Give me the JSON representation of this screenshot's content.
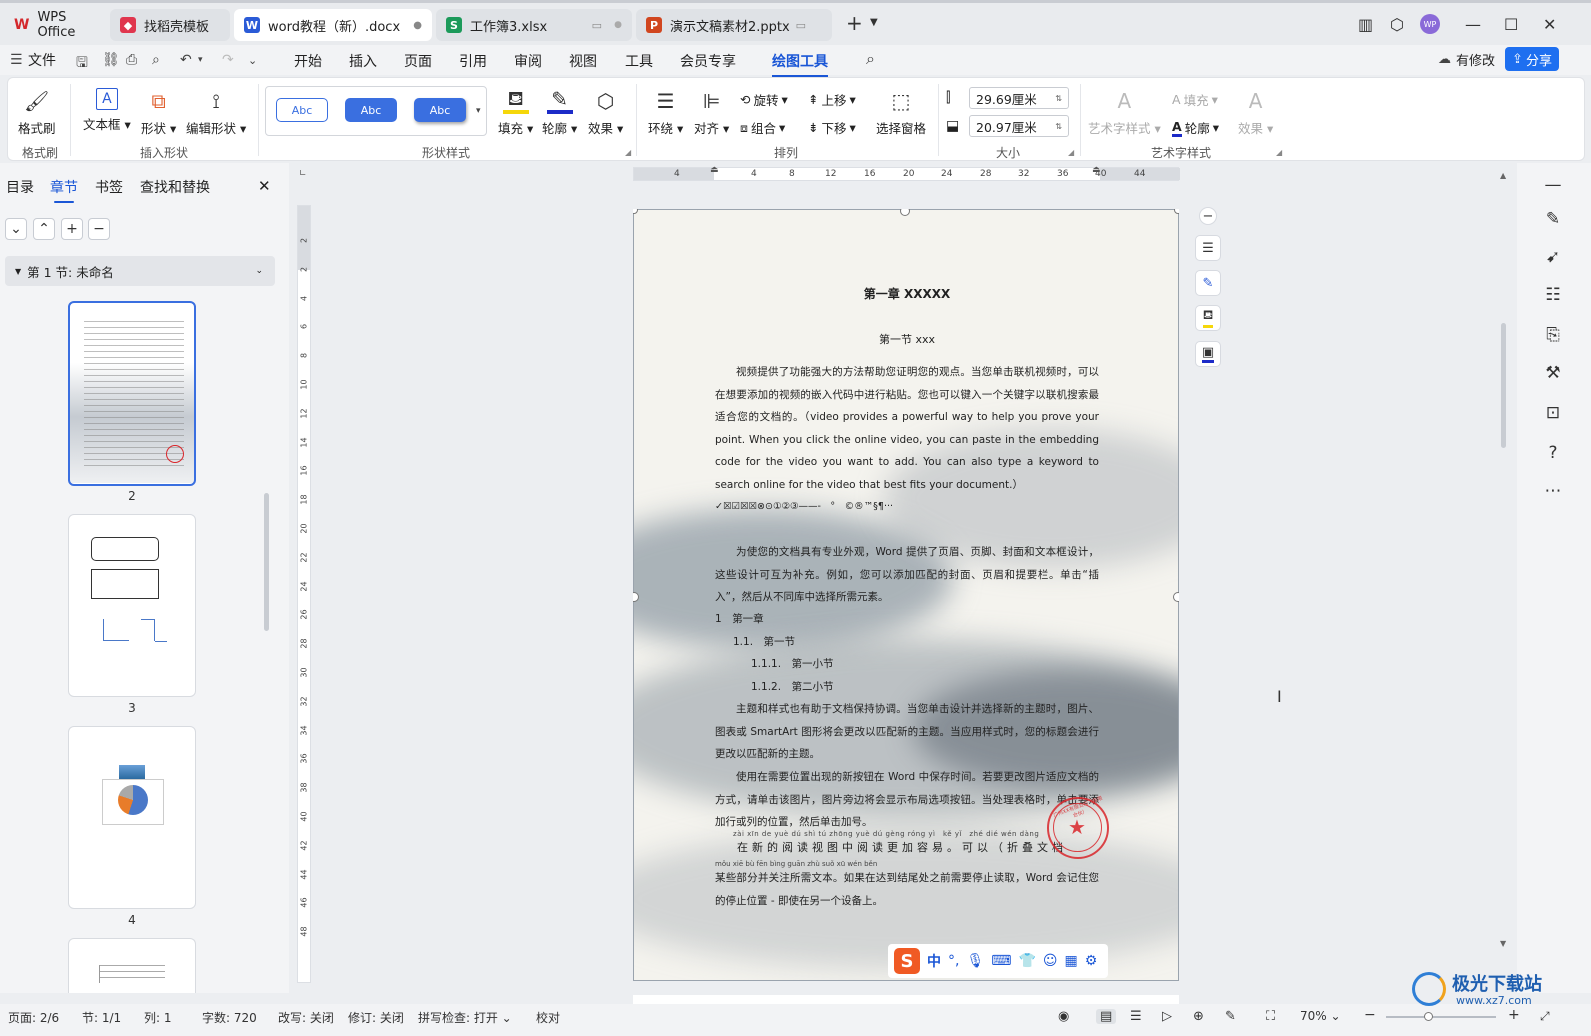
{
  "tabs": [
    {
      "label": "WPS Office",
      "icon": "wps-logo-icon",
      "color": "#d4282c"
    },
    {
      "label": "找稻壳模板",
      "icon": "docer-icon",
      "color": "#e0364e"
    },
    {
      "label": "word教程（新）.docx",
      "icon": "word-icon",
      "color": "#2b5bd7"
    },
    {
      "label": "工作簿3.xlsx",
      "icon": "excel-icon",
      "color": "#1c9a5a"
    },
    {
      "label": "演示文稿素材2.pptx",
      "icon": "ppt-icon",
      "color": "#d1461f"
    }
  ],
  "tab_icon_letters": {
    "word": "W",
    "excel": "S",
    "ppt": "P"
  },
  "user_badge": "WP",
  "menu": {
    "file": "文件",
    "items": [
      "开始",
      "插入",
      "页面",
      "引用",
      "审阅",
      "视图",
      "工具",
      "会员专享",
      "绘图工具"
    ],
    "active": "绘图工具",
    "revise": "有修改",
    "share": "分享"
  },
  "ribbon": {
    "format_brush": "格式刷",
    "text_box": "文本框",
    "shape": "形状",
    "edit_shape": "编辑形状",
    "style_samples": [
      "Abc",
      "Abc",
      "Abc"
    ],
    "fill": "填充",
    "outline": "轮廓",
    "effect": "效果",
    "wrap": "环绕",
    "align": "对齐",
    "rotate": "旋转",
    "group": "组合",
    "move_up": "上移",
    "move_down": "下移",
    "select_pane": "选择窗格",
    "height": "29.69厘米",
    "width": "20.97厘米",
    "art_style": "艺术字样式",
    "art_fill": "填充",
    "art_outline": "轮廓",
    "art_effect": "效果",
    "groups": {
      "brush": "格式刷",
      "insert_shape": "插入形状",
      "shape_style": "形状样式",
      "arrange": "排列",
      "size": "大小",
      "art": "艺术字样式"
    }
  },
  "left_pane": {
    "tabs": [
      "目录",
      "章节",
      "书签",
      "查找和替换"
    ],
    "active_tab": "章节",
    "section": "第 1 节: 未命名",
    "pages": [
      "2",
      "3",
      "4"
    ]
  },
  "ruler": {
    "h": [
      "4",
      "4",
      "8",
      "12",
      "16",
      "20",
      "24",
      "28",
      "32",
      "36",
      "40",
      "44"
    ],
    "v": [
      "2",
      "2",
      "4",
      "6",
      "8",
      "10",
      "12",
      "14",
      "16",
      "18",
      "20",
      "22",
      "24",
      "26",
      "28",
      "30",
      "32",
      "34",
      "36",
      "38",
      "40",
      "42",
      "44",
      "46",
      "48"
    ]
  },
  "document": {
    "chapter": "第一章 XXXXX",
    "section": "第一节 xxx",
    "p1": "视频提供了功能强大的方法帮助您证明您的观点。当您单击联机视频时，可以在想要添加的视频的嵌入代码中进行粘贴。您也可以键入一个关键字以联机搜索最适合您的文档的。（video provides a powerful way to help you prove your point. When you click the online video, you can paste in the embedding code for the video you want to add. You can also type a keyword to search online for the video that best fits your document.）",
    "symbols": "✓☒☑☒☒⊗⊙①②③——-　°　©®™§¶···",
    "p2": "为使您的文档具有专业外观，Word 提供了页眉、页脚、封面和文本框设计，这些设计可互为补充。例如，您可以添加匹配的封面、页眉和提要栏。单击“插入”，然后从不同库中选择所需元素。",
    "list": [
      {
        "num": "1",
        "text": "第一章"
      },
      {
        "num": "1.1.",
        "text": "第一节"
      },
      {
        "num": "1.1.1.",
        "text": "第一小节"
      },
      {
        "num": "1.1.2.",
        "text": "第二小节"
      }
    ],
    "p3": "主题和样式也有助于文档保持协调。当您单击设计并选择新的主题时，图片、图表或 SmartArt 图形将会更改以匹配新的主题。当应用样式时，您的标题会进行更改以匹配新的主题。",
    "p4": "使用在需要位置出现的新按钮在 Word 中保存时间。若要更改图片适应文档的方式，请单击该图片，图片旁边将会显示布局选项按钮。当处理表格时，单击要添加行或列的位置，然后单击加号。",
    "pinyin1": "zài xīn de yuè dú shì tú zhōng yuè dú gèng róng yì　kě yǐ　zhé dié wén dàng",
    "p5": "在新的阅读视图中阅读更加容易。可以（折叠文档",
    "pinyin2": "mǒu xiē bù fēn bìng guān zhù suǒ xū wén běn",
    "p6": "某些部分并关注所需文本。如果在达到结尾处之前需要停止读取，Word 会记住您的停止位置 - 即使在另一个设备上。",
    "seal_text": "广州XX有限公司（有限合伙）",
    "seal_color": "#d9262b"
  },
  "ime": {
    "mode": "中",
    "logo": "S"
  },
  "status": {
    "page": "页面: 2/6",
    "section": "节: 1/1",
    "column": "列: 1",
    "words": "字数: 720",
    "rewrite": "改写: 关闭",
    "revise": "修订: 关闭",
    "spell": "拼写检查: 打开",
    "proof": "校对",
    "zoom": "70%"
  },
  "watermark": {
    "text": "极光下载站",
    "url": "www.xz7.com"
  },
  "colors": {
    "accent": "#1a56d6",
    "share_bg": "#1e6ff0"
  }
}
